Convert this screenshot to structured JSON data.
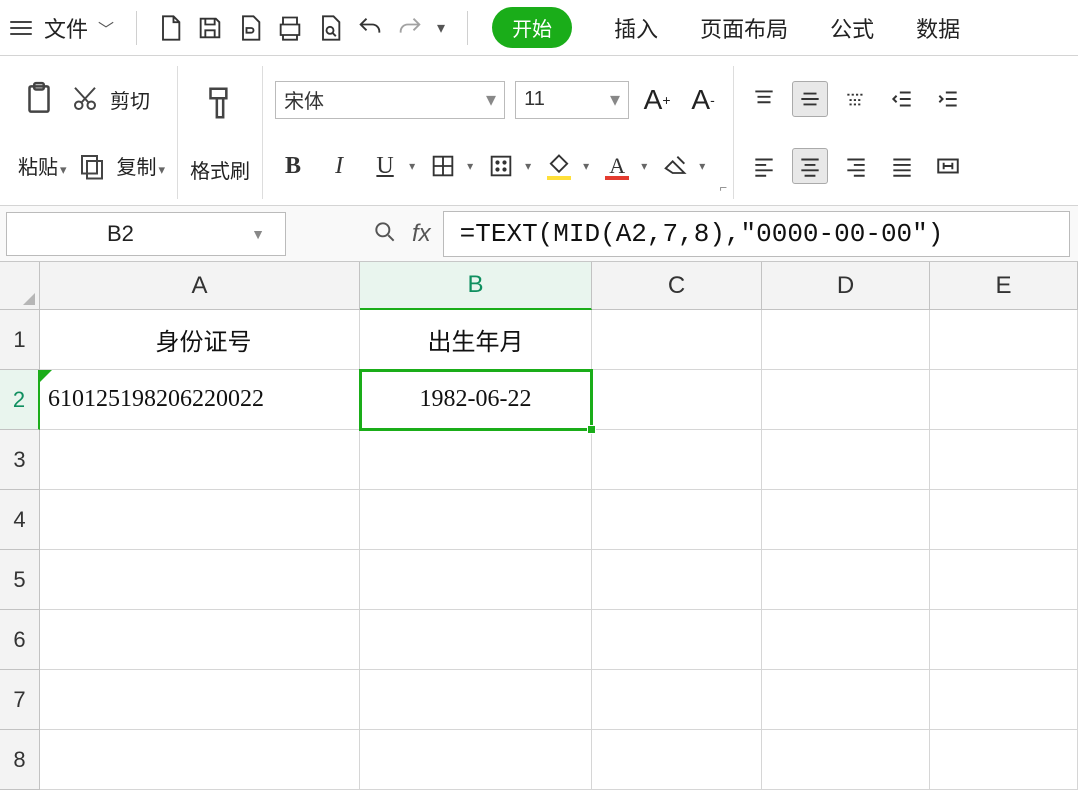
{
  "menubar": {
    "file_label": "文件",
    "tabs": {
      "start": "开始",
      "insert": "插入",
      "page_layout": "页面布局",
      "formulas": "公式",
      "data": "数据"
    }
  },
  "ribbon": {
    "clipboard": {
      "paste": "粘贴",
      "cut": "剪切",
      "copy": "复制",
      "format_painter": "格式刷"
    },
    "font": {
      "name": "宋体",
      "size": "11",
      "increase": "A",
      "decrease": "A",
      "bold": "B",
      "italic": "I",
      "underline": "U",
      "font_color_letter": "A"
    }
  },
  "formula_bar": {
    "cell_ref": "B2",
    "formula": "=TEXT(MID(A2,7,8),\"0000-00-00\")"
  },
  "grid": {
    "columns": [
      "A",
      "B",
      "C",
      "D",
      "E"
    ],
    "rows": [
      "1",
      "2",
      "3",
      "4",
      "5",
      "6",
      "7",
      "8"
    ],
    "active_col": "B",
    "active_row": "2",
    "cells": {
      "A1": "身份证号",
      "B1": "出生年月",
      "A2": "610125198206220022",
      "B2": "1982-06-22"
    }
  }
}
